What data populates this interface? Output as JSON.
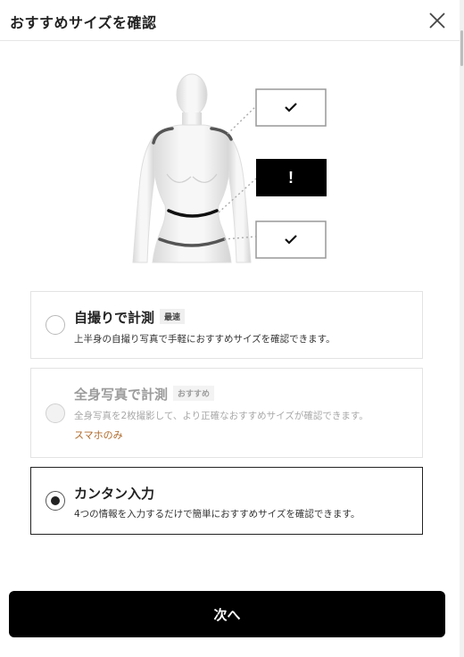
{
  "header": {
    "title": "おすすめサイズを確認",
    "close_icon": "close-icon"
  },
  "figure": {
    "markers": [
      {
        "region": "shoulder",
        "status": "ok",
        "symbol": "✓"
      },
      {
        "region": "bust",
        "status": "alert",
        "symbol": "!"
      },
      {
        "region": "hip",
        "status": "ok",
        "symbol": "✓"
      }
    ]
  },
  "options": [
    {
      "title": "自撮りで計測",
      "badge": "最速",
      "description": "上半身の自撮り写真で手軽におすすめサイズを確認できます。",
      "selected": false,
      "disabled": false
    },
    {
      "title": "全身写真で計測",
      "badge": "おすすめ",
      "description": "全身写真を2枚撮影して、より正確なおすすめサイズが確認できます。",
      "note": "スマホのみ",
      "selected": false,
      "disabled": true
    },
    {
      "title": "カンタン入力",
      "description": "4つの情報を入力するだけで簡単におすすめサイズを確認できます。",
      "selected": true,
      "disabled": false
    }
  ],
  "footer": {
    "next_label": "次へ"
  },
  "colors": {
    "primary": "#000000",
    "note": "#b06a2a",
    "border": "#e3e3e3"
  }
}
